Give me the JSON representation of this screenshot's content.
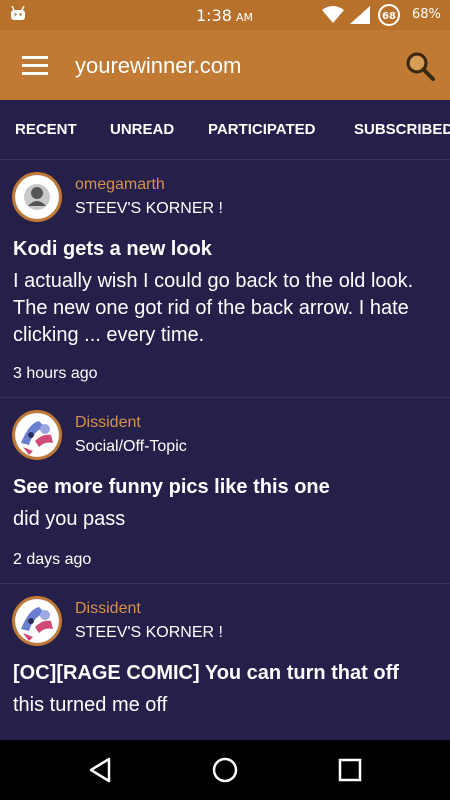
{
  "status_bar": {
    "time": "1:38",
    "ampm": "AM",
    "battery_percent": "68%",
    "battery_badge": "68"
  },
  "app_bar": {
    "title": "yourewinner.com"
  },
  "tabs": [
    "RECENT",
    "UNREAD",
    "PARTICIPATED",
    "SUBSCRIBED"
  ],
  "active_tab": "RECENT",
  "posts": [
    {
      "author": "omegamarth",
      "forum": "STEEV'S KORNER !",
      "title": "Kodi gets a new look",
      "excerpt": "I actually wish I could go back to the old look. The new one got rid of the back arrow. I hate clicking ... every time.",
      "time": "3 hours ago",
      "avatar": "default-user-avatar"
    },
    {
      "author": "Dissident",
      "forum": "Social/Off-Topic",
      "title": "See more funny pics like this one",
      "excerpt": "did you pass",
      "time": "2 days ago",
      "avatar": "character-avatar"
    },
    {
      "author": "Dissident",
      "forum": "STEEV'S KORNER !",
      "title": "[OC][RAGE COMIC] You can turn that off",
      "excerpt": "this turned me off",
      "avatar": "character-avatar"
    }
  ],
  "colors": {
    "background": "#24204a",
    "app_bar": "#c07a34",
    "status_bar": "#b8712a",
    "author_text": "#d8914a",
    "nav_bar": "#000000"
  }
}
